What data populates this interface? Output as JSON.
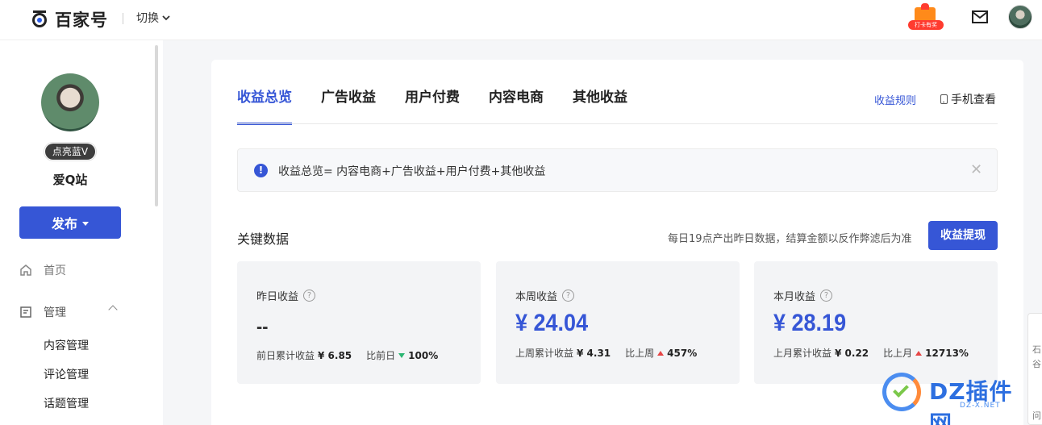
{
  "header": {
    "logo_text": "百家号",
    "switch_label": "切换",
    "gift_label": "打卡有奖"
  },
  "sidebar": {
    "badge": "点亮蓝V",
    "nickname": "爱Q站",
    "publish_label": "发布",
    "nav": {
      "home": "首页",
      "manage": "管理",
      "sub_items": [
        "内容管理",
        "评论管理",
        "话题管理"
      ]
    }
  },
  "main": {
    "tabs": [
      "收益总览",
      "广告收益",
      "用户付费",
      "内容电商",
      "其他收益"
    ],
    "active_tab": "收益总览",
    "rules_link": "收益规则",
    "phone_link": "手机查看",
    "notice": "收益总览= 内容电商+广告收益+用户付费+其他收益",
    "key_data_title": "关键数据",
    "key_data_note": "每日19点产出昨日数据，结算金额以反作弊滤后为准",
    "withdraw_label": "收益提现",
    "stats": [
      {
        "label": "昨日收益",
        "value": "--",
        "prev_label": "前日累计收益",
        "prev_value": "¥ 6.85",
        "cmp_label": "比前日",
        "cmp_value": "100%",
        "trend": "down"
      },
      {
        "label": "本周收益",
        "value": "¥ 24.04",
        "prev_label": "上周累计收益",
        "prev_value": "¥ 4.31",
        "cmp_label": "比上周",
        "cmp_value": "457%",
        "trend": "up"
      },
      {
        "label": "本月收益",
        "value": "¥ 28.19",
        "prev_label": "上月累计收益",
        "prev_value": "¥ 0.22",
        "cmp_label": "比上月",
        "cmp_value": "12713%",
        "trend": "up"
      }
    ]
  },
  "watermark": {
    "text": "DZ插件网",
    "sub": "DZ-X.NET"
  },
  "colors": {
    "accent": "#3656d6",
    "up": "#e64545",
    "down": "#2bb673"
  }
}
